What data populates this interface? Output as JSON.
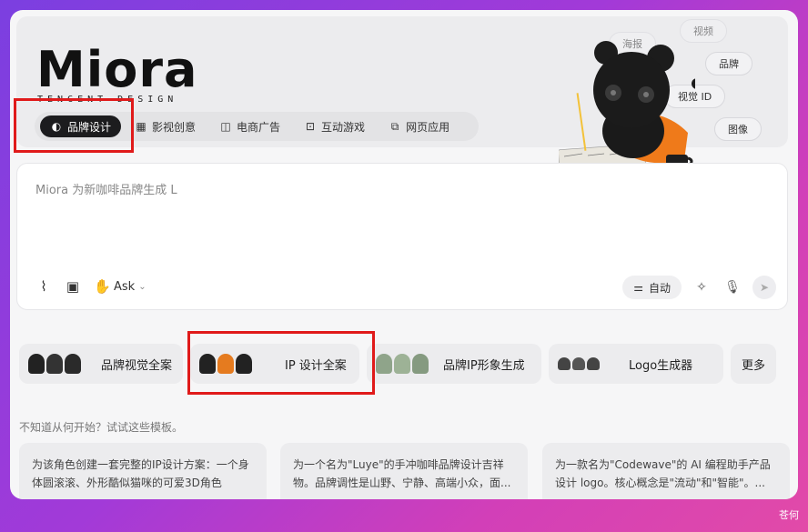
{
  "brand": {
    "word": "Miora",
    "sub": "TENCENT DESIGN"
  },
  "categories": [
    {
      "icon": "palette-icon",
      "glyph": "◐",
      "label": "品牌设计",
      "active": true
    },
    {
      "icon": "film-icon",
      "glyph": "▦",
      "label": "影视创意",
      "active": false
    },
    {
      "icon": "shopping-bag-icon",
      "glyph": "◫",
      "label": "电商广告",
      "active": false
    },
    {
      "icon": "gamepad-icon",
      "glyph": "⊡",
      "label": "互动游戏",
      "active": false
    },
    {
      "icon": "web-app-icon",
      "glyph": "⧉",
      "label": "网页应用",
      "active": false
    }
  ],
  "hero_tags": {
    "poster": "海报",
    "video": "视频",
    "brand": "品牌",
    "visual_id": "视觉 ID",
    "image": "图像"
  },
  "composer": {
    "prompt": "Miora 为新咖啡品牌生成 L",
    "ask_label": "Ask",
    "auto_label": "自动"
  },
  "cards": [
    {
      "label": "品牌视觉全案"
    },
    {
      "label": "IP 设计全案"
    },
    {
      "label": "品牌IP形象生成"
    },
    {
      "label": "Logo生成器"
    },
    {
      "label": "更多"
    }
  ],
  "hint": "不知道从何开始？试试这些模板。",
  "templates": [
    {
      "text": "为该角色创建一套完整的IP设计方案：一个身体圆滚滚、外形酷似猫咪的可爱3D角色"
    },
    {
      "text": "为一个名为\"Luye\"的手冲咖啡品牌设计吉祥物。品牌调性是山野、宁静、高端小众，面..."
    },
    {
      "text": "为一款名为\"Codewave\"的 AI 编程助手产品设计 logo。核心概念是\"流动\"和\"智能\"。..."
    }
  ],
  "corner_text": "苍何",
  "colors": {
    "highlight": "#e01a1a",
    "active_tab": "#1c1c1e"
  }
}
